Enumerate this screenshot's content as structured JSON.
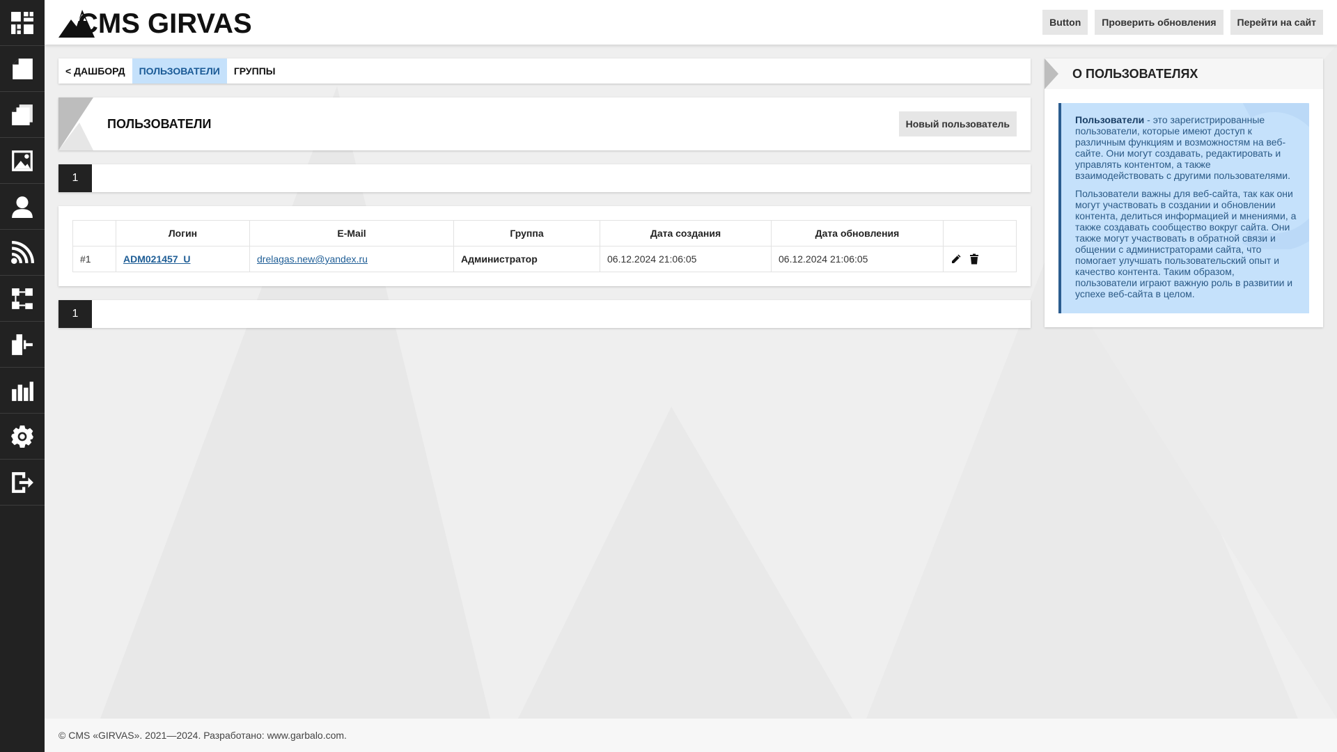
{
  "app": {
    "logo_text": "CMS GIRVAS"
  },
  "sidebar": {
    "items": [
      {
        "name": "dashboard-icon"
      },
      {
        "name": "pages-icon"
      },
      {
        "name": "documents-icon"
      },
      {
        "name": "image-icon"
      },
      {
        "name": "user-icon"
      },
      {
        "name": "rss-icon"
      },
      {
        "name": "structure-icon"
      },
      {
        "name": "modules-icon"
      },
      {
        "name": "stats-icon"
      },
      {
        "name": "gear-icon"
      },
      {
        "name": "logout-icon"
      }
    ]
  },
  "header": {
    "buttons": {
      "button": "Button",
      "check_updates": "Проверить обновления",
      "go_to_site": "Перейти на сайт"
    }
  },
  "breadcrumb": {
    "dashboard": "< Дашборд",
    "users": "Пользователи",
    "groups": "Группы"
  },
  "page": {
    "title": "Пользователи",
    "new_user_button": "Новый пользователь"
  },
  "pagination": {
    "current_page": "1"
  },
  "table": {
    "columns": [
      "",
      "Логин",
      "E-Mail",
      "Группа",
      "Дата создания",
      "Дата обновления",
      ""
    ],
    "rows": [
      {
        "id": "#1",
        "login": "ADM021457_U",
        "email": "drelagas.new@yandex.ru",
        "group": "Администратор",
        "created": "06.12.2024 21:06:05",
        "updated": "06.12.2024 21:06:05"
      }
    ]
  },
  "aside": {
    "title": "О пользователях",
    "p1_bold": "Пользователи",
    "p1_text": " - это зарегистрированные пользователи, которые имеют доступ к различным функциям и возможностям на веб-сайте. Они могут создавать, редактировать и управлять контентом, а также взаимодействовать с другими пользователями.",
    "p2_text": "Пользователи важны для веб-сайта, так как они могут участвовать в создании и обновлении контента, делиться информацией и мнениями, а также создавать сообщество вокруг сайта. Они также могут участвовать в обратной связи и общении с администраторами сайта, что помогает улучшать пользовательский опыт и качество контента. Таким образом, пользователи играют важную роль в развитии и успехе веб-сайта в целом."
  },
  "footer": {
    "text": "© CMS «GIRVAS». 2021—2024. Разработано: www.garbalo.com."
  },
  "colors": {
    "sidebar_bg": "#222222",
    "accent_light": "#c5e1fb",
    "accent_dark": "#2b5c8f",
    "page_bg": "#efefef"
  }
}
